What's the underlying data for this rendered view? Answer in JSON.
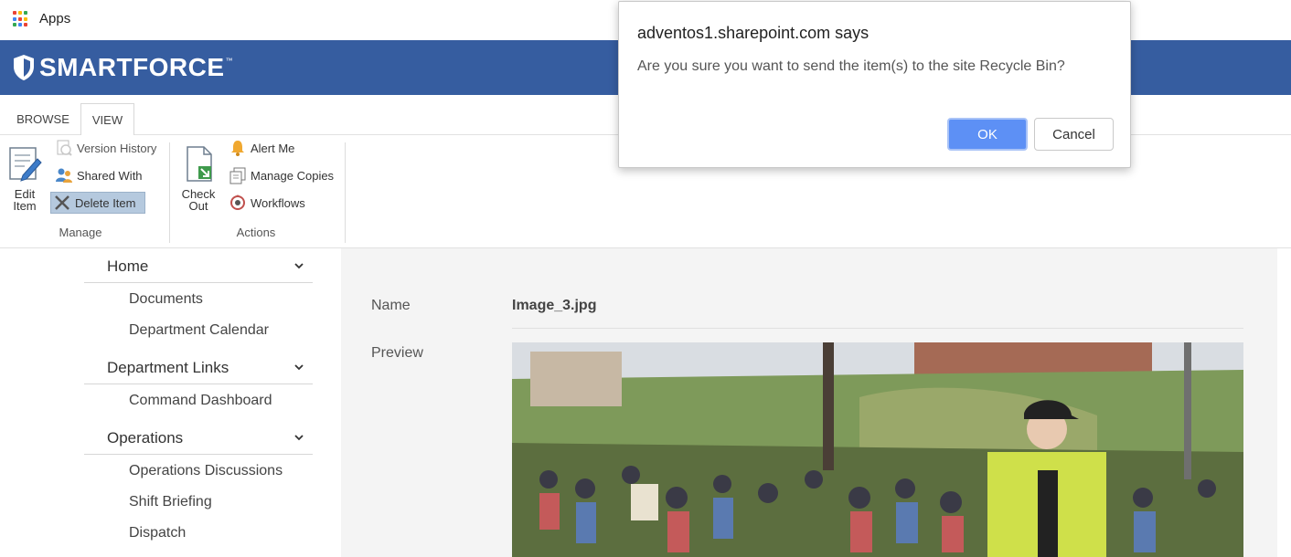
{
  "browser": {
    "bookmarks_apps_label": "Apps"
  },
  "brand": {
    "name": "SMARTFORCE",
    "trademark": "™",
    "bar_color": "#365da0"
  },
  "ribbon": {
    "tabs": [
      {
        "label": "BROWSE"
      },
      {
        "label": "VIEW"
      }
    ],
    "manage": {
      "group_label": "Manage",
      "edit_item": "Edit\nItem",
      "version_history": "Version History",
      "shared_with": "Shared With",
      "delete_item": "Delete Item"
    },
    "actions": {
      "group_label": "Actions",
      "check_out": "Check\nOut",
      "alert_me": "Alert Me",
      "manage_copies": "Manage Copies",
      "workflows": "Workflows"
    }
  },
  "nav": {
    "sections": [
      {
        "label": "Home",
        "items": [
          "Documents",
          "Department Calendar"
        ]
      },
      {
        "label": "Department Links",
        "items": [
          "Command Dashboard"
        ]
      },
      {
        "label": "Operations",
        "items": [
          "Operations Discussions",
          "Shift Briefing",
          "Dispatch"
        ]
      }
    ]
  },
  "item": {
    "name_label": "Name",
    "name_value": "Image_3.jpg",
    "preview_label": "Preview"
  },
  "dialog": {
    "title": "adventos1.sharepoint.com says",
    "message": "Are you sure you want to send the item(s) to the site Recycle Bin?",
    "ok_label": "OK",
    "cancel_label": "Cancel",
    "ok_color": "#5d90f5"
  }
}
